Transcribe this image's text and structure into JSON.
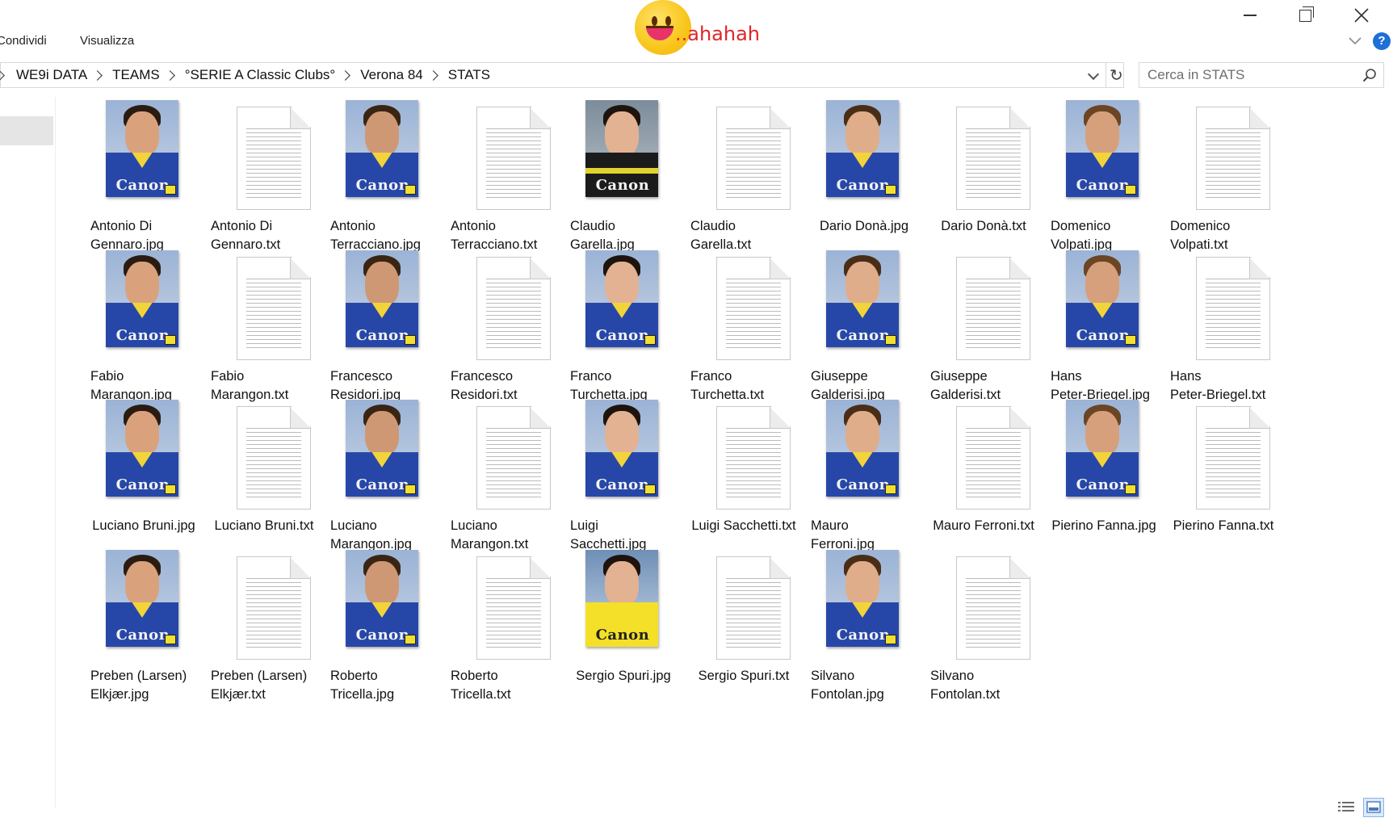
{
  "ribbon": {
    "tab_share": "Condividi",
    "tab_view": "Visualizza",
    "overlay_text": "..ahahah",
    "overlay_icon": "smiley-face-icon"
  },
  "address": {
    "crumbs": [
      "WE9i DATA",
      "TEAMS",
      "°SERIE A Classic Clubs°",
      "Verona 84",
      "STATS"
    ]
  },
  "search": {
    "placeholder": "Cerca in STATS"
  },
  "colors": {
    "jersey_blue": "#2747a8",
    "jersey_yellow": "#f2d43a",
    "keeper_yellow": "#f4e029",
    "keeper_black": "#1b1b1b",
    "accent": "#1e6fd6"
  },
  "files": [
    {
      "name": "Antonio Di Gennaro.jpg",
      "line1": "Antonio Di",
      "line2": "Gennaro.jpg",
      "type": "jpg",
      "kit": "blue"
    },
    {
      "name": "Antonio Di Gennaro.txt",
      "line1": "Antonio Di",
      "line2": "Gennaro.txt",
      "type": "txt"
    },
    {
      "name": "Antonio Terracciano.jpg",
      "line1": "Antonio",
      "line2": "Terracciano.jpg",
      "type": "jpg",
      "kit": "blue"
    },
    {
      "name": "Antonio Terracciano.txt",
      "line1": "Antonio",
      "line2": "Terracciano.txt",
      "type": "txt"
    },
    {
      "name": "Claudio Garella.jpg",
      "line1": "Claudio",
      "line2": "Garella.jpg",
      "type": "jpg",
      "kit": "keeper-black"
    },
    {
      "name": "Claudio Garella.txt",
      "line1": "Claudio",
      "line2": "Garella.txt",
      "type": "txt"
    },
    {
      "name": "Dario Donà.jpg",
      "line1": "Dario Donà.jpg",
      "line2": "",
      "type": "jpg",
      "kit": "blue"
    },
    {
      "name": "Dario Donà.txt",
      "line1": "Dario Donà.txt",
      "line2": "",
      "type": "txt"
    },
    {
      "name": "Domenico Volpati.jpg",
      "line1": "Domenico",
      "line2": "Volpati.jpg",
      "type": "jpg",
      "kit": "blue"
    },
    {
      "name": "Domenico Volpati.txt",
      "line1": "Domenico",
      "line2": "Volpati.txt",
      "type": "txt"
    },
    {
      "name": "Fabio Marangon.jpg",
      "line1": "Fabio",
      "line2": "Marangon.jpg",
      "type": "jpg",
      "kit": "blue"
    },
    {
      "name": "Fabio Marangon.txt",
      "line1": "Fabio",
      "line2": "Marangon.txt",
      "type": "txt"
    },
    {
      "name": "Francesco Residori.jpg",
      "line1": "Francesco",
      "line2": "Residori.jpg",
      "type": "jpg",
      "kit": "blue"
    },
    {
      "name": "Francesco Residori.txt",
      "line1": "Francesco",
      "line2": "Residori.txt",
      "type": "txt"
    },
    {
      "name": "Franco Turchetta.jpg",
      "line1": "Franco",
      "line2": "Turchetta.jpg",
      "type": "jpg",
      "kit": "blue"
    },
    {
      "name": "Franco Turchetta.txt",
      "line1": "Franco",
      "line2": "Turchetta.txt",
      "type": "txt"
    },
    {
      "name": "Giuseppe Galderisi.jpg",
      "line1": "Giuseppe",
      "line2": "Galderisi.jpg",
      "type": "jpg",
      "kit": "blue"
    },
    {
      "name": "Giuseppe Galderisi.txt",
      "line1": "Giuseppe",
      "line2": "Galderisi.txt",
      "type": "txt"
    },
    {
      "name": "Hans Peter-Briegel.jpg",
      "line1": "Hans",
      "line2": "Peter-Briegel.jpg",
      "type": "jpg",
      "kit": "blue"
    },
    {
      "name": "Hans Peter-Briegel.txt",
      "line1": "Hans",
      "line2": "Peter-Briegel.txt",
      "type": "txt"
    },
    {
      "name": "Luciano Bruni.jpg",
      "line1": "Luciano Bruni.jpg",
      "line2": "",
      "type": "jpg",
      "kit": "blue"
    },
    {
      "name": "Luciano Bruni.txt",
      "line1": "Luciano Bruni.txt",
      "line2": "",
      "type": "txt"
    },
    {
      "name": "Luciano Marangon.jpg",
      "line1": "Luciano",
      "line2": "Marangon.jpg",
      "type": "jpg",
      "kit": "blue"
    },
    {
      "name": "Luciano Marangon.txt",
      "line1": "Luciano",
      "line2": "Marangon.txt",
      "type": "txt"
    },
    {
      "name": "Luigi Sacchetti.jpg",
      "line1": "Luigi",
      "line2": "Sacchetti.jpg",
      "type": "jpg",
      "kit": "blue"
    },
    {
      "name": "Luigi Sacchetti.txt",
      "line1": "Luigi Sacchetti.txt",
      "line2": "",
      "type": "txt"
    },
    {
      "name": "Mauro Ferroni.jpg",
      "line1": "Mauro",
      "line2": "Ferroni.jpg",
      "type": "jpg",
      "kit": "blue"
    },
    {
      "name": "Mauro Ferroni.txt",
      "line1": "Mauro Ferroni.txt",
      "line2": "",
      "type": "txt"
    },
    {
      "name": "Pierino Fanna.jpg",
      "line1": "Pierino Fanna.jpg",
      "line2": "",
      "type": "jpg",
      "kit": "blue"
    },
    {
      "name": "Pierino Fanna.txt",
      "line1": "Pierino Fanna.txt",
      "line2": "",
      "type": "txt"
    },
    {
      "name": "Preben (Larsen) Elkjær.jpg",
      "line1": "Preben (Larsen)",
      "line2": "Elkjær.jpg",
      "type": "jpg",
      "kit": "blue"
    },
    {
      "name": "Preben (Larsen) Elkjær.txt",
      "line1": "Preben (Larsen)",
      "line2": "Elkjær.txt",
      "type": "txt"
    },
    {
      "name": "Roberto Tricella.jpg",
      "line1": "Roberto",
      "line2": "Tricella.jpg",
      "type": "jpg",
      "kit": "blue"
    },
    {
      "name": "Roberto Tricella.txt",
      "line1": "Roberto",
      "line2": "Tricella.txt",
      "type": "txt"
    },
    {
      "name": "Sergio Spuri.jpg",
      "line1": "Sergio Spuri.jpg",
      "line2": "",
      "type": "jpg",
      "kit": "keeper-yellow"
    },
    {
      "name": "Sergio Spuri.txt",
      "line1": "Sergio Spuri.txt",
      "line2": "",
      "type": "txt"
    },
    {
      "name": "Silvano Fontolan.jpg",
      "line1": "Silvano",
      "line2": "Fontolan.jpg",
      "type": "jpg",
      "kit": "blue"
    },
    {
      "name": "Silvano Fontolan.txt",
      "line1": "Silvano",
      "line2": "Fontolan.txt",
      "type": "txt"
    }
  ],
  "photo_brand": "Canon",
  "statusbar": {
    "view_details_icon": "details-view-icon",
    "view_large_icon": "large-icons-view-icon"
  }
}
